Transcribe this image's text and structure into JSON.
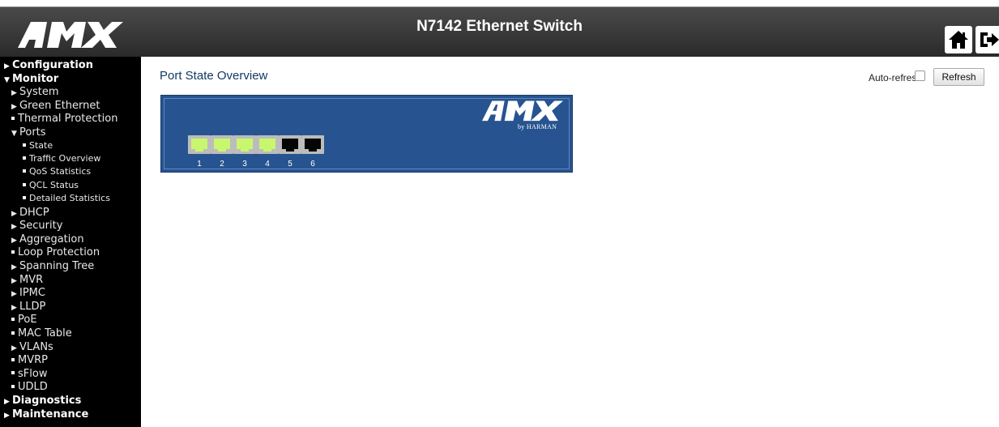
{
  "header": {
    "logo_text": "AMX",
    "title": "N7142 Ethernet Switch",
    "icons": [
      "home-icon",
      "logout-icon",
      "help-icon"
    ],
    "background": "#3a3a3a"
  },
  "sidebar": {
    "items": [
      {
        "label": "Configuration",
        "level": 0,
        "marker": "collapsed"
      },
      {
        "label": "Monitor",
        "level": 0,
        "marker": "expanded"
      },
      {
        "label": "System",
        "level": 1,
        "marker": "collapsed"
      },
      {
        "label": "Green Ethernet",
        "level": 1,
        "marker": "collapsed"
      },
      {
        "label": "Thermal Protection",
        "level": 1,
        "marker": "leaf"
      },
      {
        "label": "Ports",
        "level": 1,
        "marker": "expanded"
      },
      {
        "label": "State",
        "level": 2,
        "marker": "leaf"
      },
      {
        "label": "Traffic Overview",
        "level": 2,
        "marker": "leaf"
      },
      {
        "label": "QoS Statistics",
        "level": 2,
        "marker": "leaf"
      },
      {
        "label": "QCL Status",
        "level": 2,
        "marker": "leaf"
      },
      {
        "label": "Detailed Statistics",
        "level": 2,
        "marker": "leaf"
      },
      {
        "label": "DHCP",
        "level": 1,
        "marker": "collapsed"
      },
      {
        "label": "Security",
        "level": 1,
        "marker": "collapsed"
      },
      {
        "label": "Aggregation",
        "level": 1,
        "marker": "collapsed"
      },
      {
        "label": "Loop Protection",
        "level": 1,
        "marker": "leaf"
      },
      {
        "label": "Spanning Tree",
        "level": 1,
        "marker": "collapsed"
      },
      {
        "label": "MVR",
        "level": 1,
        "marker": "collapsed"
      },
      {
        "label": "IPMC",
        "level": 1,
        "marker": "collapsed"
      },
      {
        "label": "LLDP",
        "level": 1,
        "marker": "collapsed"
      },
      {
        "label": "PoE",
        "level": 1,
        "marker": "leaf"
      },
      {
        "label": "MAC Table",
        "level": 1,
        "marker": "leaf"
      },
      {
        "label": "VLANs",
        "level": 1,
        "marker": "collapsed"
      },
      {
        "label": "MVRP",
        "level": 1,
        "marker": "leaf"
      },
      {
        "label": "sFlow",
        "level": 1,
        "marker": "leaf"
      },
      {
        "label": "UDLD",
        "level": 1,
        "marker": "leaf"
      },
      {
        "label": "Diagnostics",
        "level": 0,
        "marker": "collapsed"
      },
      {
        "label": "Maintenance",
        "level": 0,
        "marker": "collapsed"
      }
    ]
  },
  "main": {
    "title": "Port State Overview",
    "auto_refresh_label": "Auto-refresh",
    "auto_refresh_checked": false,
    "refresh_label": "Refresh"
  },
  "switch_panel": {
    "logo_text": "AMX",
    "brand_text": "by HARMAN",
    "ports": [
      {
        "number": "1",
        "status": "up"
      },
      {
        "number": "2",
        "status": "up"
      },
      {
        "number": "3",
        "status": "up"
      },
      {
        "number": "4",
        "status": "up"
      },
      {
        "number": "5",
        "status": "down"
      },
      {
        "number": "6",
        "status": "down"
      }
    ],
    "colors": {
      "panel": "#275490",
      "link_up": "#c8f76f",
      "link_down": "#050505"
    }
  }
}
